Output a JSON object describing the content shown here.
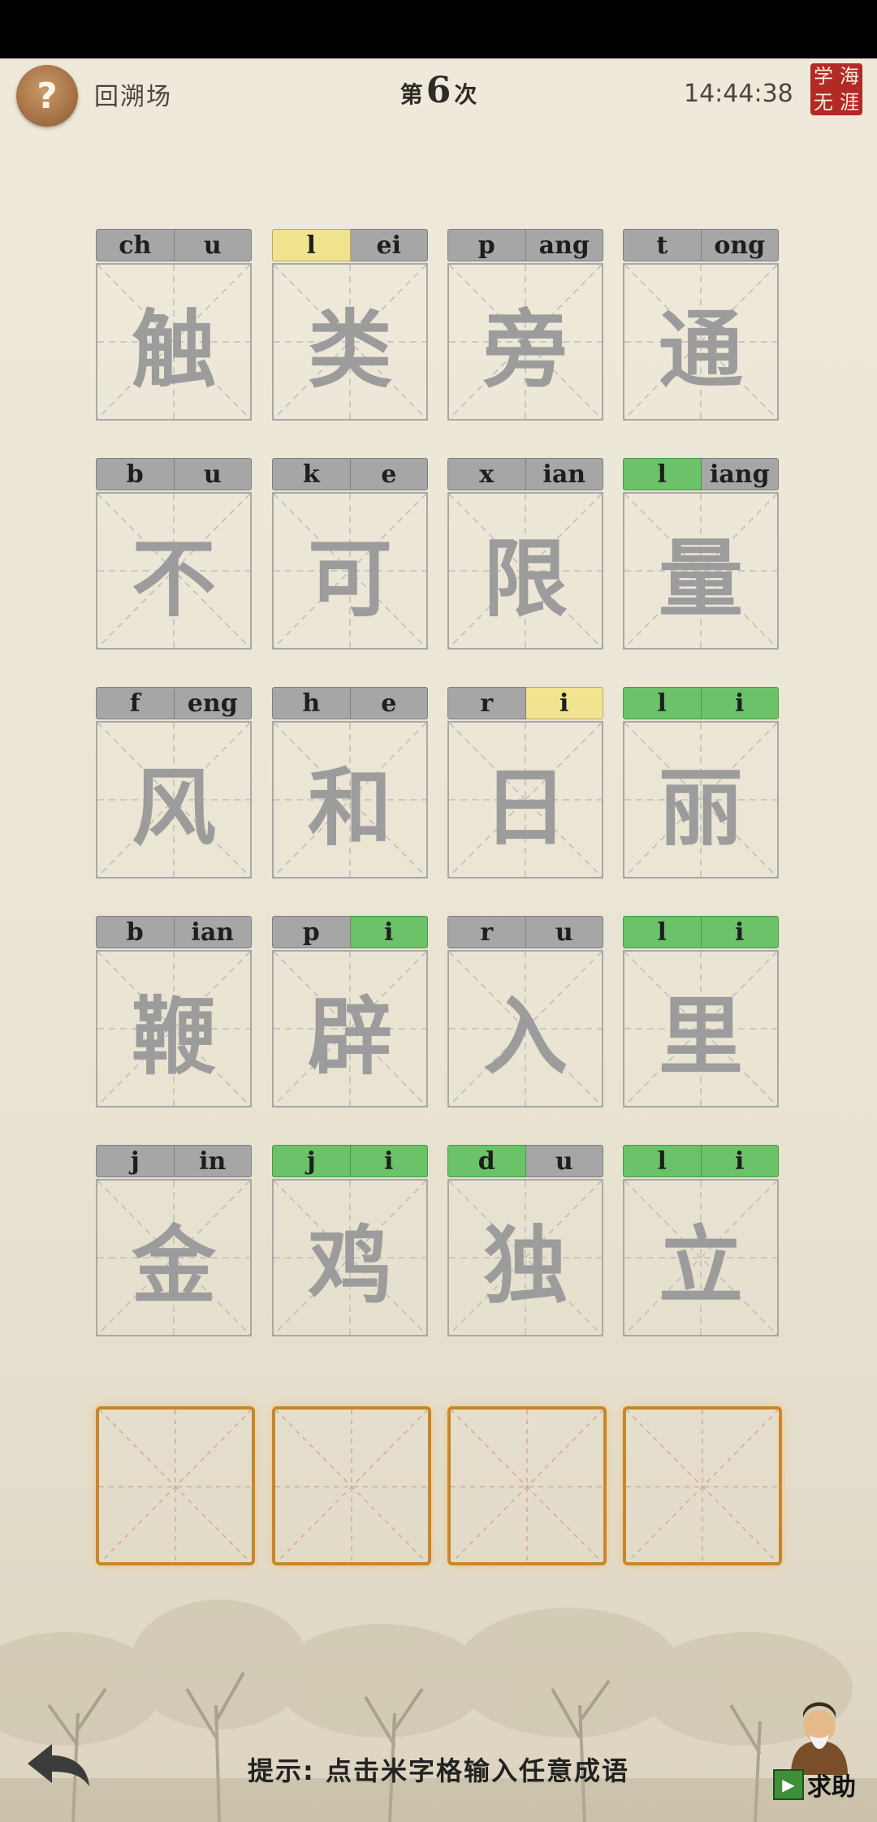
{
  "header": {
    "help_symbol": "?",
    "back_label": "回溯场",
    "round_prefix": "第",
    "round_number": "6",
    "round_suffix": "次",
    "time": "14:44:38",
    "seal_chars": [
      "学",
      "海",
      "无",
      "涯"
    ]
  },
  "grid": [
    [
      {
        "char": "触",
        "initial": "ch",
        "final": "u",
        "initial_state": "none",
        "final_state": "none"
      },
      {
        "char": "类",
        "initial": "l",
        "final": "ei",
        "initial_state": "yellow",
        "final_state": "none"
      },
      {
        "char": "旁",
        "initial": "p",
        "final": "ang",
        "initial_state": "none",
        "final_state": "none"
      },
      {
        "char": "通",
        "initial": "t",
        "final": "ong",
        "initial_state": "none",
        "final_state": "none"
      }
    ],
    [
      {
        "char": "不",
        "initial": "b",
        "final": "u",
        "initial_state": "none",
        "final_state": "none"
      },
      {
        "char": "可",
        "initial": "k",
        "final": "e",
        "initial_state": "none",
        "final_state": "none"
      },
      {
        "char": "限",
        "initial": "x",
        "final": "ian",
        "initial_state": "none",
        "final_state": "none"
      },
      {
        "char": "量",
        "initial": "l",
        "final": "iang",
        "initial_state": "green",
        "final_state": "none"
      }
    ],
    [
      {
        "char": "风",
        "initial": "f",
        "final": "eng",
        "initial_state": "none",
        "final_state": "none"
      },
      {
        "char": "和",
        "initial": "h",
        "final": "e",
        "initial_state": "none",
        "final_state": "none"
      },
      {
        "char": "日",
        "initial": "r",
        "final": "i",
        "initial_state": "none",
        "final_state": "yellow"
      },
      {
        "char": "丽",
        "initial": "l",
        "final": "i",
        "initial_state": "green",
        "final_state": "green"
      }
    ],
    [
      {
        "char": "鞭",
        "initial": "b",
        "final": "ian",
        "initial_state": "none",
        "final_state": "none"
      },
      {
        "char": "辟",
        "initial": "p",
        "final": "i",
        "initial_state": "none",
        "final_state": "green"
      },
      {
        "char": "入",
        "initial": "r",
        "final": "u",
        "initial_state": "none",
        "final_state": "none"
      },
      {
        "char": "里",
        "initial": "l",
        "final": "i",
        "initial_state": "green",
        "final_state": "green"
      }
    ],
    [
      {
        "char": "金",
        "initial": "j",
        "final": "in",
        "initial_state": "none",
        "final_state": "none"
      },
      {
        "char": "鸡",
        "initial": "j",
        "final": "i",
        "initial_state": "green",
        "final_state": "green"
      },
      {
        "char": "独",
        "initial": "d",
        "final": "u",
        "initial_state": "green",
        "final_state": "none"
      },
      {
        "char": "立",
        "initial": "l",
        "final": "i",
        "initial_state": "green",
        "final_state": "green"
      }
    ]
  ],
  "input_cells": [
    "",
    "",
    "",
    ""
  ],
  "footer": {
    "hint": "提示: 点击米字格输入任意成语",
    "seek_help_label": "求助",
    "undo_icon": "curved-back-arrow-icon",
    "play_icon": "play-icon",
    "sage_icon": "sage-avatar-icon"
  },
  "colors": {
    "tile_gray": "#A6A6A6",
    "hint_yellow": "#F0E490",
    "correct_green": "#6CC268",
    "input_border": "#C8862B",
    "seal_red": "#B22A25"
  }
}
